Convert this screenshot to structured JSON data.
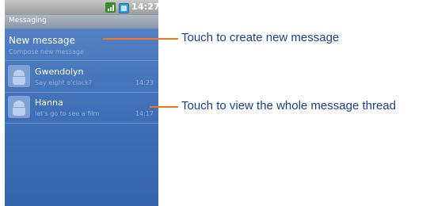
{
  "status_bar": {
    "time": "14:27"
  },
  "app": {
    "title": "Messaging"
  },
  "new_message": {
    "label": "New message",
    "subtitle": "Compose new message"
  },
  "conversations": [
    {
      "name": "Gwendolyn",
      "snippet": "Say eight o'clock?",
      "time": "14:23"
    },
    {
      "name": "Hanna",
      "snippet": "let's go to see a film",
      "time": "14:17"
    }
  ],
  "callouts": [
    {
      "text": "Touch to create new message"
    },
    {
      "text": "Touch to view the whole message thread"
    }
  ],
  "colors": {
    "callout_line": "#f07820",
    "callout_text": "#1a3f8f",
    "screen_bg": "#3f6fb6"
  }
}
